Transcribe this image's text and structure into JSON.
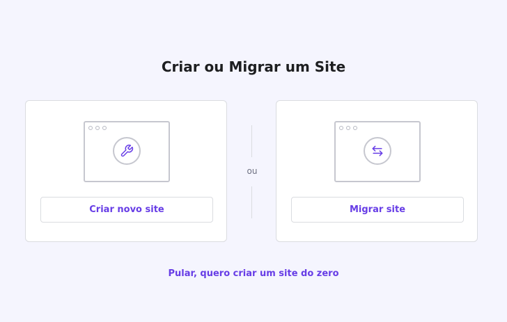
{
  "page": {
    "title": "Criar ou Migrar um Site",
    "separator": "ou",
    "skip_link": "Pular, quero criar um site do zero"
  },
  "cards": [
    {
      "icon": "wrench-icon",
      "button_label": "Criar novo site"
    },
    {
      "icon": "arrows-exchange-icon",
      "button_label": "Migrar site"
    }
  ],
  "colors": {
    "background": "#f5f5fe",
    "accent": "#673de6",
    "title": "#1d1e20",
    "border": "#dadce0",
    "icon_gray": "#c6c7cf"
  }
}
